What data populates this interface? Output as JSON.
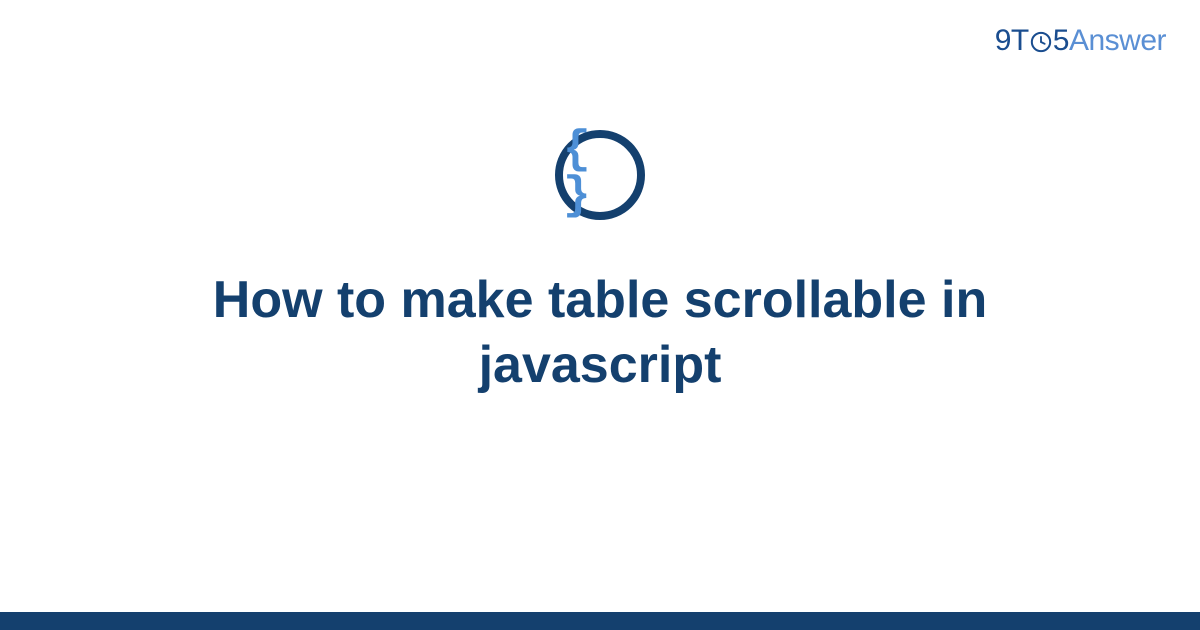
{
  "logo": {
    "part_9t": "9T",
    "part_5": "5",
    "part_answer": "Answer"
  },
  "icon": {
    "name": "code-braces-icon",
    "glyph": "{ }"
  },
  "title": "How to make table scrollable in javascript",
  "colors": {
    "primary_dark": "#14406e",
    "primary_light": "#5a8fd4",
    "accent_blue": "#4d8fd6"
  }
}
